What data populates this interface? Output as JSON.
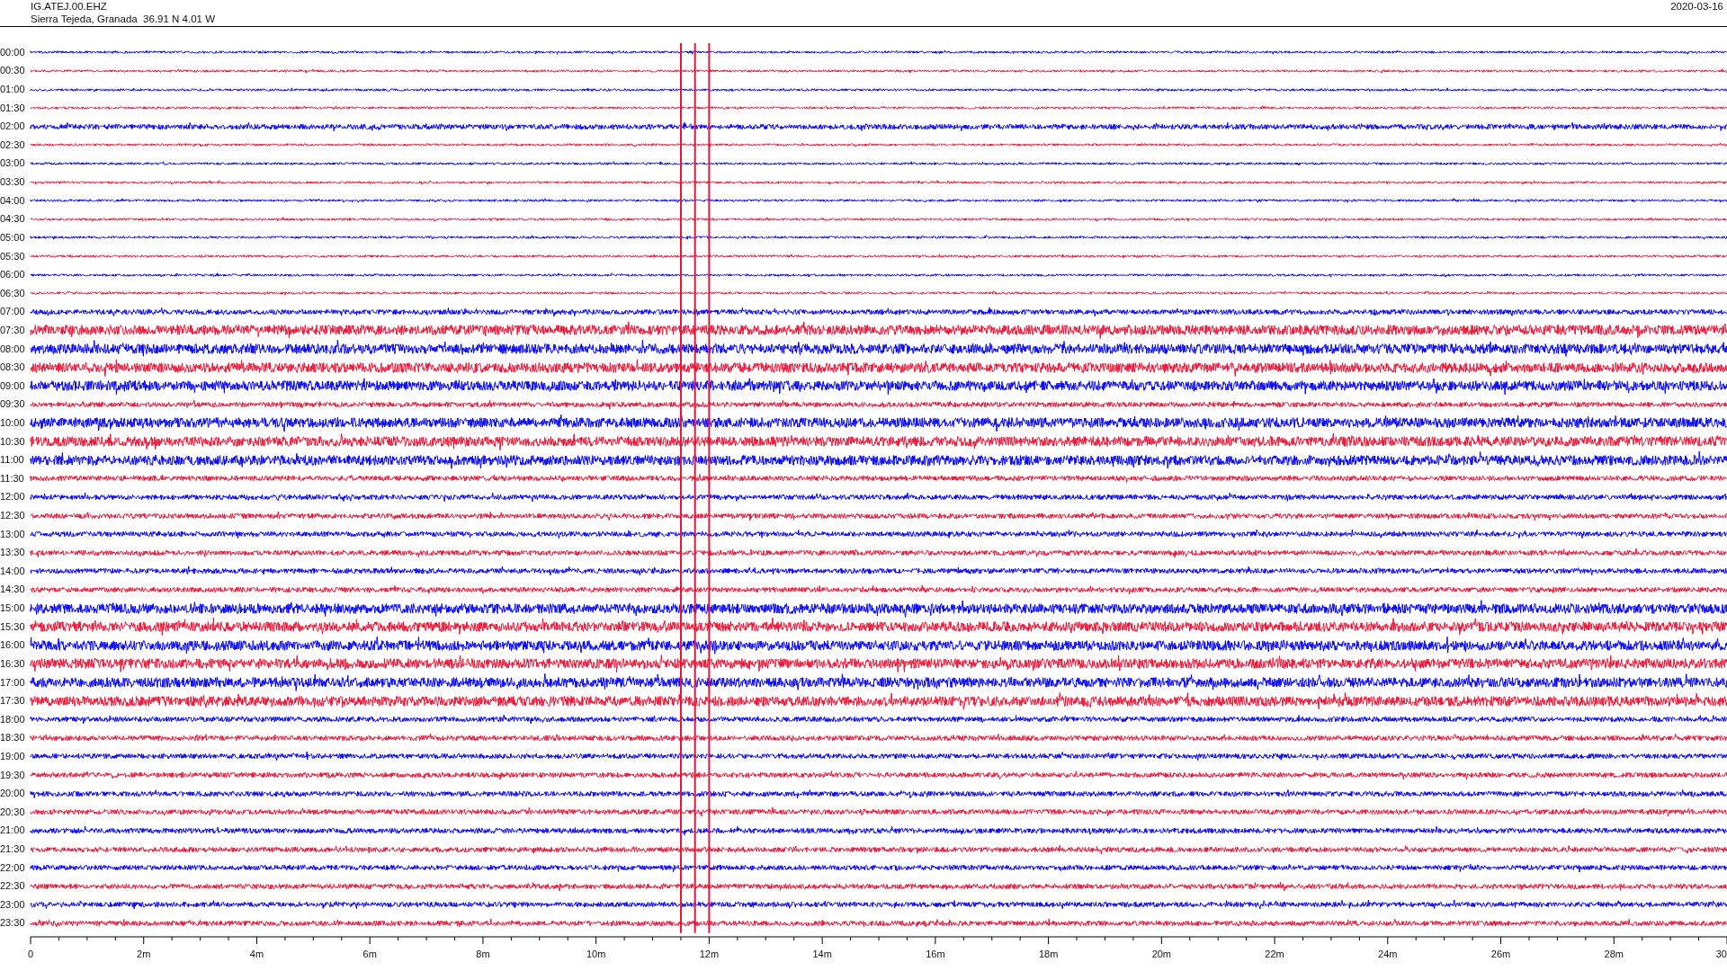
{
  "header": {
    "station": "IG.ATEJ.00.EHZ",
    "location": "Sierra Tejeda, Granada  36.91 N 4.01 W",
    "date": "2020-03-16"
  },
  "rows": [
    {
      "time": "00:00",
      "color": "#0000ff",
      "kind": "low"
    },
    {
      "time": "00:30",
      "color": "#ee1133",
      "kind": "low"
    },
    {
      "time": "01:00",
      "color": "#0000ff",
      "kind": "low"
    },
    {
      "time": "01:30",
      "color": "#ee1133",
      "kind": "low"
    },
    {
      "time": "02:00",
      "color": "#0000ff",
      "kind": "medium"
    },
    {
      "time": "02:30",
      "color": "#ee1133",
      "kind": "low"
    },
    {
      "time": "03:00",
      "color": "#0000ff",
      "kind": "low"
    },
    {
      "time": "03:30",
      "color": "#ee1133",
      "kind": "low"
    },
    {
      "time": "04:00",
      "color": "#0000ff",
      "kind": "low"
    },
    {
      "time": "04:30",
      "color": "#ee1133",
      "kind": "low"
    },
    {
      "time": "05:00",
      "color": "#0000ff",
      "kind": "low"
    },
    {
      "time": "05:30",
      "color": "#ee1133",
      "kind": "low"
    },
    {
      "time": "06:00",
      "color": "#0000ff",
      "kind": "low"
    },
    {
      "time": "06:30",
      "color": "#ee1133",
      "kind": "low"
    },
    {
      "time": "07:00",
      "color": "#0000ff",
      "kind": "medium"
    },
    {
      "time": "07:30",
      "color": "#ee1133",
      "kind": "high"
    },
    {
      "time": "08:00",
      "color": "#0000ff",
      "kind": "high"
    },
    {
      "time": "08:30",
      "color": "#ee1133",
      "kind": "high"
    },
    {
      "time": "09:00",
      "color": "#0000ff",
      "kind": "high"
    },
    {
      "time": "09:30",
      "color": "#ee1133",
      "kind": "medium"
    },
    {
      "time": "10:00",
      "color": "#0000ff",
      "kind": "high"
    },
    {
      "time": "10:30",
      "color": "#ee1133",
      "kind": "high"
    },
    {
      "time": "11:00",
      "color": "#0000ff",
      "kind": "high"
    },
    {
      "time": "11:30",
      "color": "#ee1133",
      "kind": "medium"
    },
    {
      "time": "12:00",
      "color": "#0000ff",
      "kind": "medium"
    },
    {
      "time": "12:30",
      "color": "#ee1133",
      "kind": "medium"
    },
    {
      "time": "13:00",
      "color": "#0000ff",
      "kind": "medium"
    },
    {
      "time": "13:30",
      "color": "#ee1133",
      "kind": "medium"
    },
    {
      "time": "14:00",
      "color": "#0000ff",
      "kind": "medium"
    },
    {
      "time": "14:30",
      "color": "#ee1133",
      "kind": "medium"
    },
    {
      "time": "15:00",
      "color": "#0000ff",
      "kind": "high"
    },
    {
      "time": "15:30",
      "color": "#ee1133",
      "kind": "high"
    },
    {
      "time": "16:00",
      "color": "#0000ff",
      "kind": "high"
    },
    {
      "time": "16:30",
      "color": "#ee1133",
      "kind": "high"
    },
    {
      "time": "17:00",
      "color": "#0000ff",
      "kind": "high"
    },
    {
      "time": "17:30",
      "color": "#ee1133",
      "kind": "high"
    },
    {
      "time": "18:00",
      "color": "#0000ff",
      "kind": "medium"
    },
    {
      "time": "18:30",
      "color": "#ee1133",
      "kind": "medium"
    },
    {
      "time": "19:00",
      "color": "#0000ff",
      "kind": "medium"
    },
    {
      "time": "19:30",
      "color": "#ee1133",
      "kind": "medium"
    },
    {
      "time": "20:00",
      "color": "#0000ff",
      "kind": "medium"
    },
    {
      "time": "20:30",
      "color": "#ee1133",
      "kind": "medium"
    },
    {
      "time": "21:00",
      "color": "#0000ff",
      "kind": "medium"
    },
    {
      "time": "21:30",
      "color": "#ee1133",
      "kind": "medium"
    },
    {
      "time": "22:00",
      "color": "#0000ff",
      "kind": "medium"
    },
    {
      "time": "22:30",
      "color": "#ee1133",
      "kind": "medium"
    },
    {
      "time": "23:00",
      "color": "#0000ff",
      "kind": "medium"
    },
    {
      "time": "23:30",
      "color": "#ee1133",
      "kind": "medium"
    }
  ],
  "axis": {
    "labels": [
      "0",
      "2m",
      "4m",
      "6m",
      "8m",
      "10m",
      "12m",
      "14m",
      "16m",
      "18m",
      "20m",
      "22m",
      "24m",
      "26m",
      "28m",
      "30"
    ]
  }
}
